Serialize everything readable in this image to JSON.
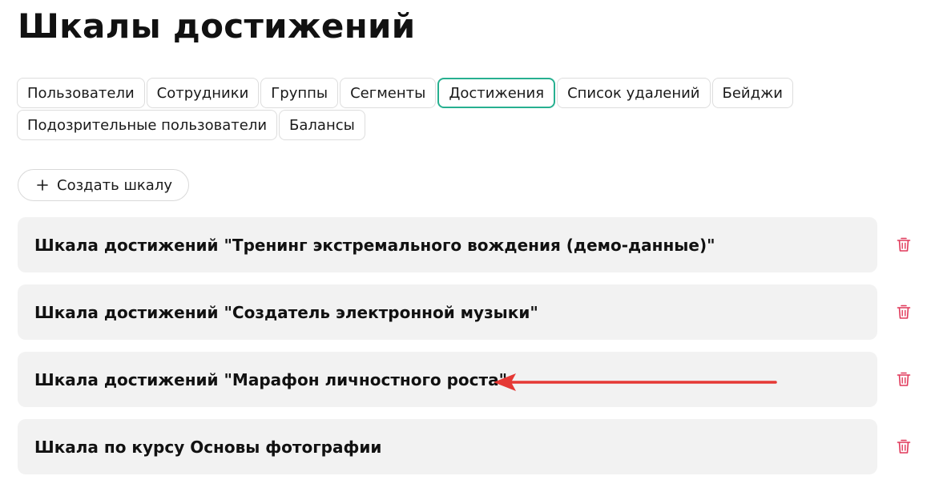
{
  "page": {
    "title": "Шкалы достижений"
  },
  "tabs": {
    "row1": [
      {
        "id": "users",
        "label": "Пользователи"
      },
      {
        "id": "employees",
        "label": "Сотрудники"
      },
      {
        "id": "groups",
        "label": "Группы"
      },
      {
        "id": "segments",
        "label": "Сегменты"
      },
      {
        "id": "achievements",
        "label": "Достижения",
        "active": true
      },
      {
        "id": "deletions",
        "label": "Список удалений"
      },
      {
        "id": "badges",
        "label": "Бейджи"
      }
    ],
    "row2": [
      {
        "id": "suspicious",
        "label": "Подозрительные пользователи"
      },
      {
        "id": "balances",
        "label": "Балансы"
      }
    ]
  },
  "actions": {
    "create_label": "Создать шкалу",
    "create_icon": "plus-icon"
  },
  "scales": [
    {
      "label": "Шкала достижений \"Тренинг экстремального вождения (демо-данные)\""
    },
    {
      "label": "Шкала достижений \"Создатель электронной музыки\""
    },
    {
      "label": "Шкала достижений \"Марафон личностного роста\""
    },
    {
      "label": "Шкала по курсу Основы фотографии"
    }
  ],
  "icons": {
    "delete": "trash-icon",
    "annotation": "arrow-icon"
  },
  "colors": {
    "accent": "#27b090",
    "delete": "#e0395a",
    "annotation": "#e53935",
    "item_bg": "#f2f2f2"
  }
}
